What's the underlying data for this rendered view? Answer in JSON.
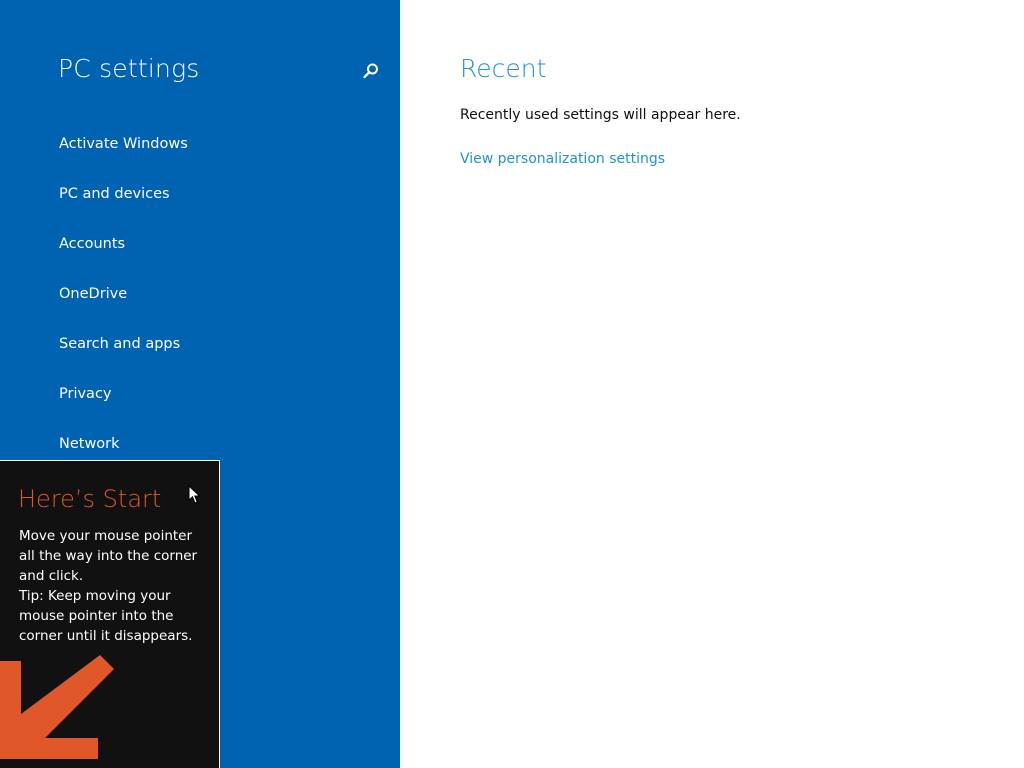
{
  "nav": {
    "title": "PC settings",
    "search_icon": "search-icon",
    "items": [
      {
        "label": "Activate Windows"
      },
      {
        "label": "PC and devices"
      },
      {
        "label": "Accounts"
      },
      {
        "label": "OneDrive"
      },
      {
        "label": "Search and apps"
      },
      {
        "label": "Privacy"
      },
      {
        "label": "Network"
      }
    ]
  },
  "content": {
    "heading": "Recent",
    "description": "Recently used settings will appear here.",
    "link": "View personalization settings"
  },
  "tip": {
    "title": "Here’s Start",
    "lines": [
      "Move your mouse pointer all the way into the corner and click.",
      "Tip: Keep moving your mouse pointer into the corner until it disappears."
    ],
    "arrow_icon": "arrow-down-left-icon"
  },
  "colors": {
    "nav_background": "#0063b1",
    "accent_text": "#1e93d2",
    "tip_title": "#e0582a",
    "tip_background": "#111111"
  }
}
